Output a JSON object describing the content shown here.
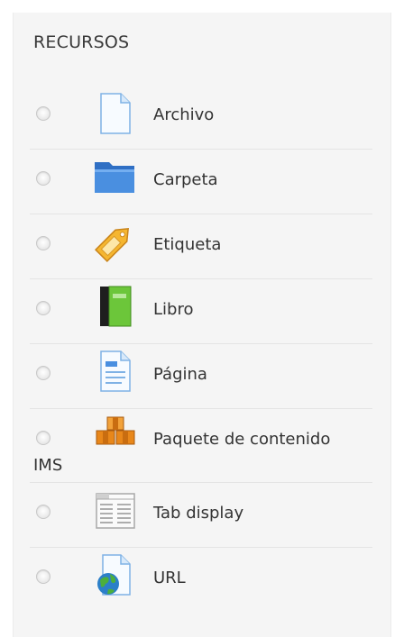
{
  "section": {
    "title": "RECURSOS"
  },
  "items": [
    {
      "label": "Archivo",
      "icon": "file-icon"
    },
    {
      "label": "Carpeta",
      "icon": "folder-icon"
    },
    {
      "label": "Etiqueta",
      "icon": "tag-icon"
    },
    {
      "label": "Libro",
      "icon": "book-icon"
    },
    {
      "label": "Página",
      "icon": "page-icon"
    },
    {
      "label": "Paquete de contenido",
      "label_cont": "IMS",
      "icon": "package-icon"
    },
    {
      "label": "Tab display",
      "icon": "tab-display-icon"
    },
    {
      "label": "URL",
      "icon": "url-icon"
    }
  ],
  "colors": {
    "panel_background": "#f5f5f5",
    "text": "#333333",
    "folder_blue": "#4a8fe0",
    "tag_orange": "#f0a020",
    "book_green": "#6cc63a",
    "package_orange": "#e8871a"
  }
}
